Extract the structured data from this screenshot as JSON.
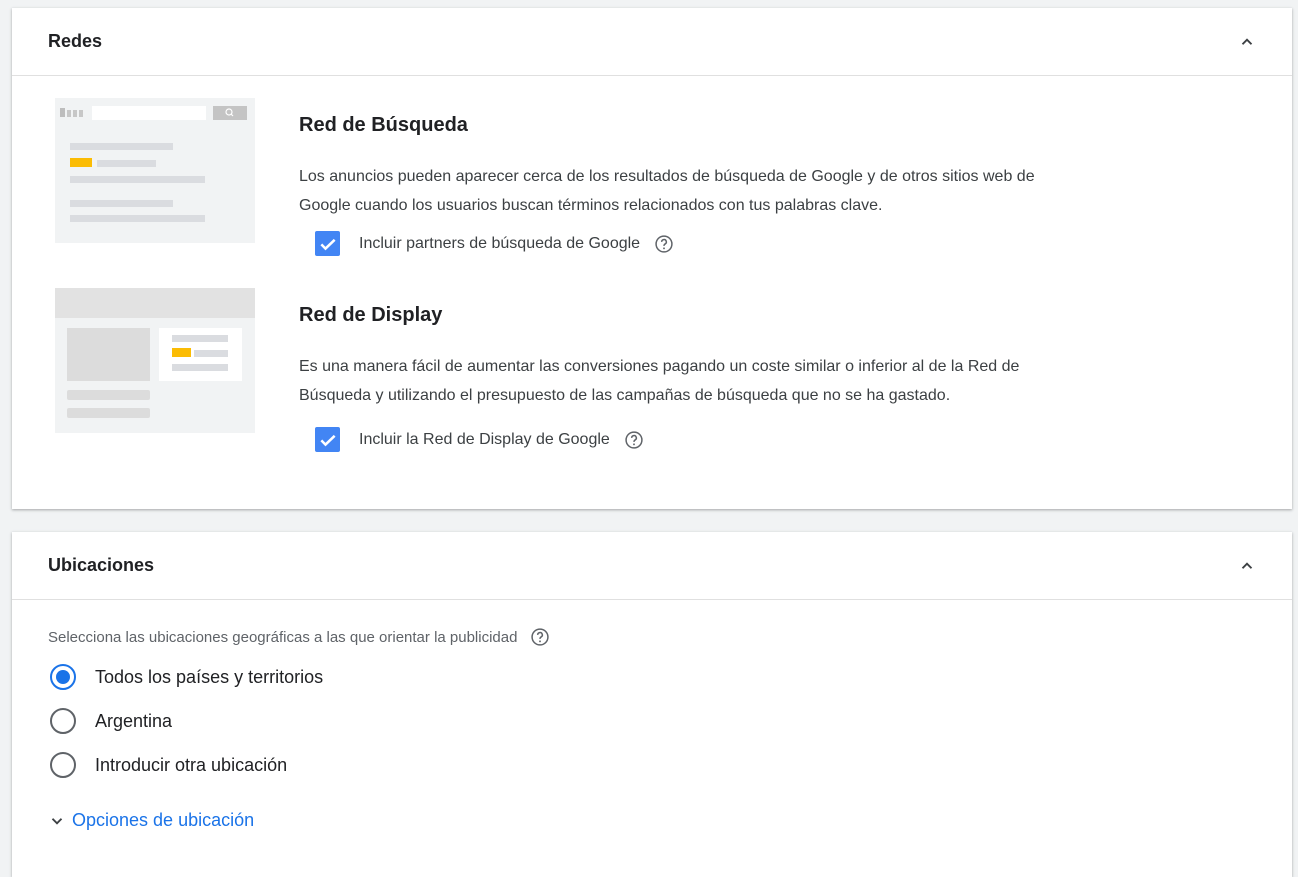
{
  "redes": {
    "title": "Redes",
    "search": {
      "title": "Red de Búsqueda",
      "description_line1": "Los anuncios pueden aparecer cerca de los resultados de búsqueda de Google y de otros sitios web de",
      "description_line2": "Google cuando los usuarios buscan términos relacionados con tus palabras clave.",
      "checkbox_label": "Incluir partners de búsqueda de Google",
      "checked": true
    },
    "display": {
      "title": "Red de Display",
      "description_line1": "Es una manera fácil de aumentar las conversiones pagando un coste similar o inferior al de la Red de",
      "description_line2": "Búsqueda y utilizando el presupuesto de las campañas de búsqueda que no se ha gastado.",
      "checkbox_label": "Incluir la Red de Display de Google",
      "checked": true
    }
  },
  "ubicaciones": {
    "title": "Ubicaciones",
    "prompt": "Selecciona las ubicaciones geográficas a las que orientar la publicidad",
    "options": [
      {
        "label": "Todos los países y territorios",
        "selected": true
      },
      {
        "label": "Argentina",
        "selected": false
      },
      {
        "label": "Introducir otra ubicación",
        "selected": false
      }
    ],
    "more_link": "Opciones de ubicación"
  },
  "colors": {
    "accent": "#1a73e8",
    "checkbox": "#4285f4",
    "highlight": "#fbbc04"
  },
  "icons": [
    "chevron-up-icon",
    "help-icon",
    "check-icon",
    "search-icon",
    "chevron-down-icon"
  ]
}
